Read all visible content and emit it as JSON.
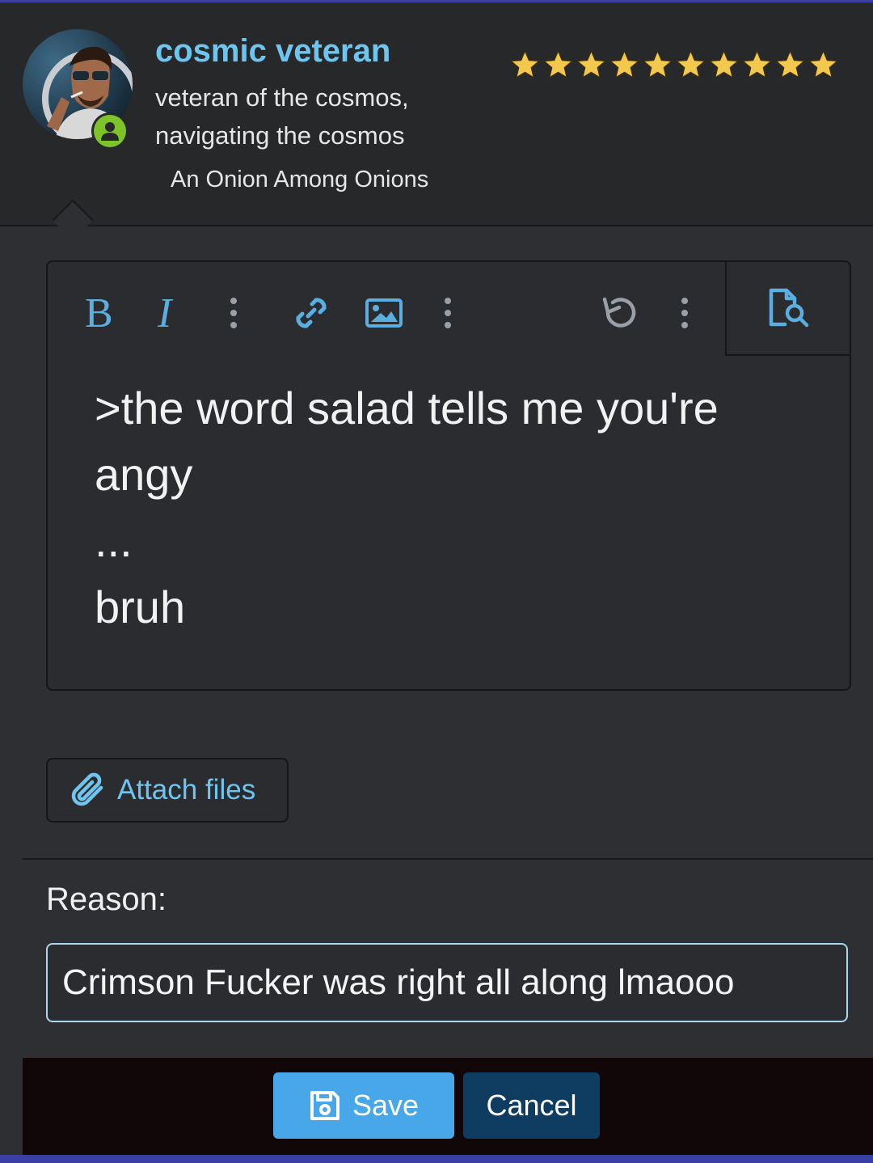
{
  "user": {
    "username": "cosmic veteran",
    "title": "veteran of the cosmos, navigating the cosmos",
    "subtitle": "An Onion Among Onions",
    "star_count": 10,
    "star_color": "#f2c94c",
    "online_color": "#7ec32a"
  },
  "toolbar": {
    "icons": [
      "bold-icon",
      "italic-icon",
      "more-options-icon",
      "link-icon",
      "image-icon",
      "more-options-icon",
      "undo-icon",
      "more-options-icon",
      "preview-icon"
    ]
  },
  "editor": {
    "lines": [
      ">the word salad tells me you're angy",
      "...",
      "bruh"
    ]
  },
  "attach": {
    "label": "Attach files",
    "icon": "paperclip-icon"
  },
  "reason": {
    "label": "Reason:",
    "value": "Crimson Fucker was right all along lmaooo"
  },
  "buttons": {
    "save": "Save",
    "cancel": "Cancel",
    "save_icon": "save-icon"
  },
  "colors": {
    "accent": "#6ec6f0",
    "save_bg": "#47a7e8",
    "cancel_bg": "#0f3d62"
  }
}
